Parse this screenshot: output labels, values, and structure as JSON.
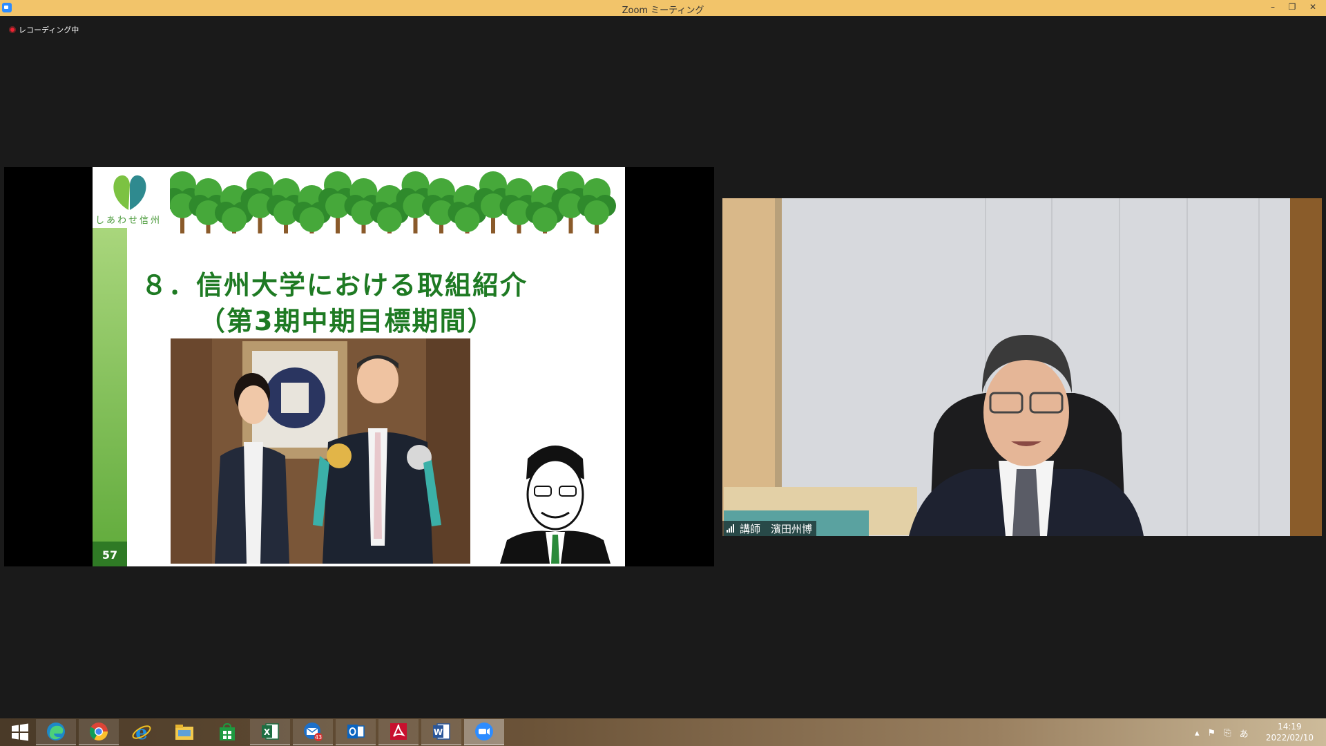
{
  "window": {
    "title": "Zoom ミーティング"
  },
  "recording": {
    "label": "レコーディング中"
  },
  "slide": {
    "logo_text": "しあわせ信州",
    "title_line1": "８．信州大学における取組紹介",
    "title_line2": "（第3期中期目標期間）",
    "page_number": "57"
  },
  "participant": {
    "name": "講師　濱田州博"
  },
  "taskbar": {
    "apps": [
      "windows-start",
      "edge",
      "chrome",
      "internet-explorer",
      "file-explorer",
      "store",
      "excel",
      "thunderbird",
      "outlook",
      "acrobat",
      "word",
      "zoom"
    ],
    "thunderbird_badge": "43",
    "tray_ime": "あ",
    "time": "14:19",
    "date": "2022/02/10"
  },
  "colors": {
    "titlebar": "#f2c46a",
    "slide_title": "#1e7a23",
    "zoom_blue": "#2d8cff"
  }
}
